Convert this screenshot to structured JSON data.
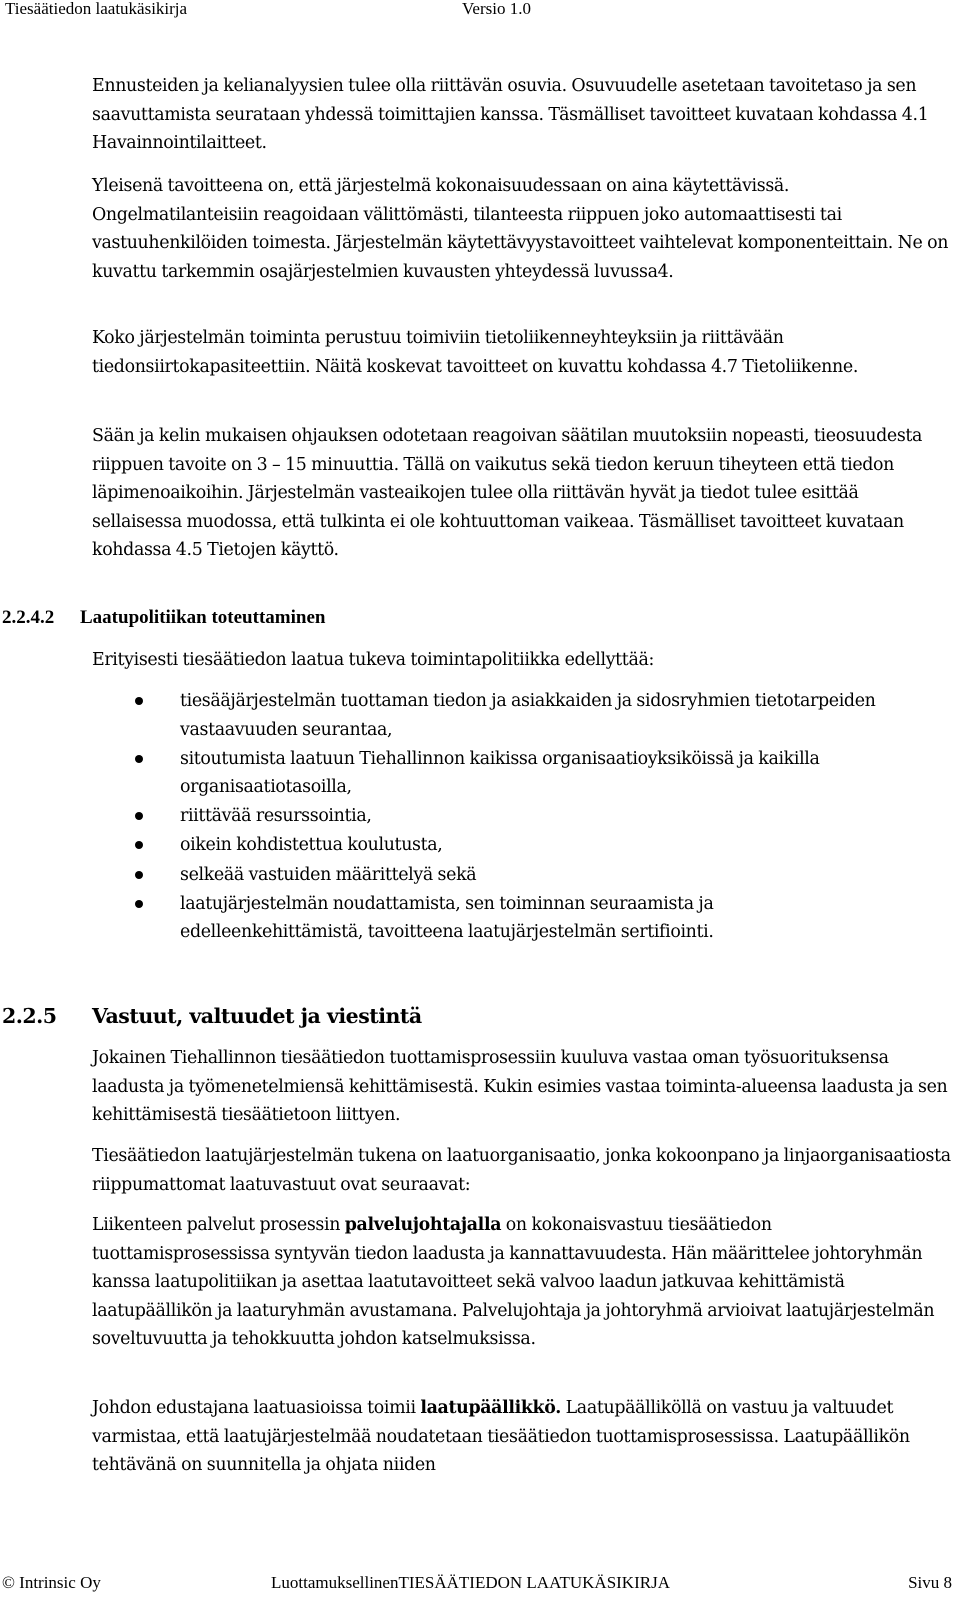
{
  "header": {
    "title": "Tiesäätiedon laatukäsikirja",
    "version": "Versio 1.0"
  },
  "body": {
    "p1": "Ennusteiden ja kelianalyysien tulee olla riittävän osuvia.  Osuvuudelle asetetaan tavoitetaso ja sen saavuttamista seurataan yhdessä toimittajien kanssa. Täsmälliset tavoitteet kuvataan kohdassa  4.1 Havainnointilaitteet.",
    "p2": "Yleisenä tavoitteena on, että järjestelmä kokonaisuudessaan on aina käytettävissä. Ongelmatilanteisiin reagoidaan välittömästi, tilanteesta riippuen joko automaattisesti tai vastuuhenkilöiden toimesta.  Järjestelmän käytettävyystavoitteet vaihtelevat komponenteittain.  Ne on kuvattu tarkemmin osajärjestelmien kuvausten yhteydessä luvussa4.",
    "p3": "Koko järjestelmän toiminta perustuu toimiviin tietoliikenneyhteyksiin ja riittävään tiedonsiirtokapasiteettiin.  Näitä koskevat tavoitteet on kuvattu kohdassa  4.7 Tietoliikenne.",
    "p4": "Sään ja kelin mukaisen ohjauksen odotetaan reagoivan säätilan muutoksiin nopeasti, tieosuudesta riippuen tavoite on 3 – 15 minuuttia.  Tällä on vaikutus sekä tiedon keruun tiheyteen että tiedon läpimenoaikoihin.  Järjestelmän vasteaikojen tulee olla riittävän hyvät ja tiedot tulee esittää sellaisessa muodossa, että tulkinta ei ole kohtuuttoman vaikeaa.  Täsmälliset tavoitteet kuvataan kohdassa 4.5 Tietojen käyttö."
  },
  "section_2242": {
    "number": "2.2.4.2",
    "title": "Laatupolitiikan toteuttaminen",
    "intro": "Erityisesti tiesäätiedon laatua tukeva toimintapolitiikka edellyttää:",
    "bullets": [
      "tiesääjärjestelmän tuottaman tiedon ja asiakkaiden ja sidosryhmien tietotarpeiden vastaavuuden seurantaa,",
      "sitoutumista laatuun Tiehallinnon kaikissa organisaatioyksiköissä ja kaikilla organisaatiotasoilla,",
      "riittävää resurssointia,",
      "oikein kohdistettua koulutusta,",
      "selkeää vastuiden määrittelyä sekä",
      "laatujärjestelmän noudattamista, sen toiminnan seuraamista ja edelleenkehittämistä, tavoitteena laatujärjestelmän sertifiointi."
    ]
  },
  "section_225": {
    "number": "2.2.5",
    "title": "Vastuut, valtuudet ja viestintä",
    "p1": "Jokainen Tiehallinnon tiesäätiedon tuottamisprosessiin kuuluva vastaa oman työsuorituksensa laadusta ja työmenetelmiensä kehittämisestä.  Kukin esimies vastaa toiminta-alueensa laadusta ja sen kehittämisestä tiesäätietoon liittyen.",
    "p2": "Tiesäätiedon laatujärjestelmän tukena on laatuorganisaatio, jonka kokoonpano ja linjaorganisaatiosta riippumattomat laatuvastuut ovat seuraavat:",
    "p3_before": "Liikenteen palvelut prosessin ",
    "p3_bold": "palvelujohtajalla",
    "p3_after": " on kokonaisvastuu tiesäätiedon tuottamisprosessissa syntyvän tiedon laadusta ja kannattavuudesta. Hän määrittelee johtoryhmän kanssa laatupolitiikan ja asettaa laatutavoitteet sekä valvoo laadun jatkuvaa kehittämistä laatupäällikön ja laaturyhmän avustamana. Palvelujohtaja ja johtoryhmä arvioivat laatujärjestelmän soveltuvuutta ja tehokkuutta johdon katselmuksissa.",
    "p4_before": "Johdon edustajana laatuasioissa toimii ",
    "p4_bold": "laatupäällikkö.",
    "p4_after": "  Laatupäälliköllä on vastuu ja valtuudet varmistaa, että laatujärjestelmää noudatetaan tiesäätiedon tuottamisprosessissa. Laatupäällikön tehtävänä on suunnitella ja ohjata niiden"
  },
  "footer": {
    "copyright": "© Intrinsic Oy",
    "center": "LuottamuksellinenTIESÄÄTIEDON LAATUKÄSIKIRJA",
    "page": "Sivu 8"
  }
}
